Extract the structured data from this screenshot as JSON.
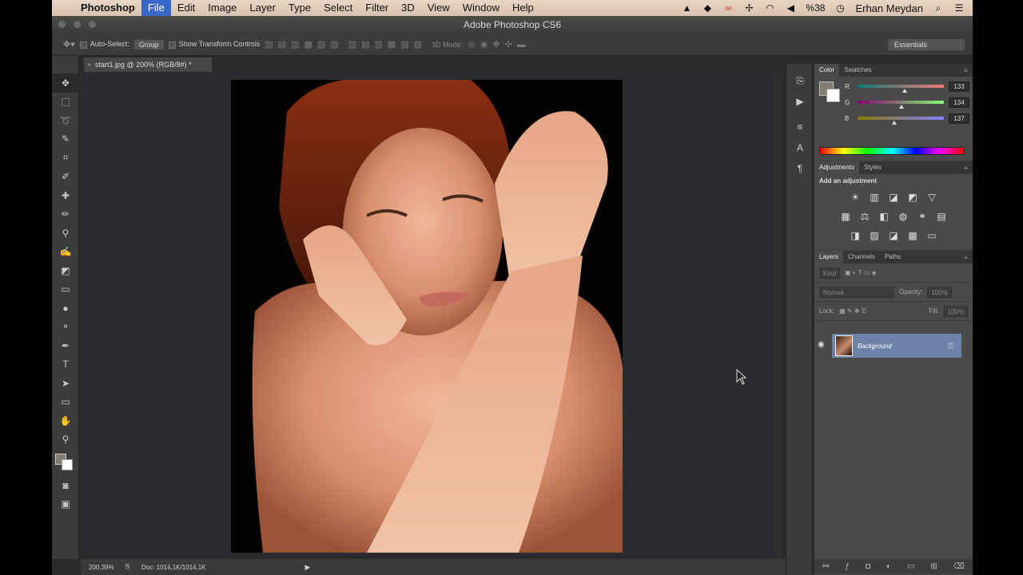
{
  "menubar": {
    "apple": "",
    "items": [
      {
        "label": "Photoshop"
      },
      {
        "label": "File"
      },
      {
        "label": "Edit"
      },
      {
        "label": "Image"
      },
      {
        "label": "Layer"
      },
      {
        "label": "Type"
      },
      {
        "label": "Select"
      },
      {
        "label": "Filter"
      },
      {
        "label": "3D"
      },
      {
        "label": "View"
      },
      {
        "label": "Window"
      },
      {
        "label": "Help"
      }
    ],
    "battery": "%38",
    "user": "Erhan Meydan",
    "search_icon": "magnifier"
  },
  "window": {
    "title": "Adobe Photoshop CS6"
  },
  "options": {
    "auto_select_label": "Auto-Select:",
    "group_value": "Group",
    "show_transform_label": "Show Transform Controls",
    "mode_3d_label": "3D Mode:",
    "workspace_value": "Essentials"
  },
  "document": {
    "tab_label": "start1.jpg @ 200% (RGB/8#) *",
    "zoom": "200,39%",
    "doc_info": "Doc: 1014,1K/1014,1K"
  },
  "tools": [
    "move-tool",
    "marquee-tool",
    "lasso-tool",
    "quick-select-tool",
    "crop-tool",
    "eyedropper-tool",
    "healing-brush-tool",
    "brush-tool",
    "clone-stamp-tool",
    "history-brush-tool",
    "eraser-tool",
    "gradient-tool",
    "blur-tool",
    "dodge-tool",
    "pen-tool",
    "type-tool",
    "path-select-tool",
    "rectangle-tool",
    "hand-tool",
    "zoom-tool"
  ],
  "color_panel": {
    "tabs": [
      {
        "label": "Color"
      },
      {
        "label": "Swatches"
      }
    ],
    "rows": [
      {
        "label": "R",
        "value": "133",
        "fraction": 0.52
      },
      {
        "label": "G",
        "value": "134",
        "fraction": 0.48
      },
      {
        "label": "B",
        "value": "137",
        "fraction": 0.4
      }
    ],
    "foreground": "#857d73",
    "background": "#ffffff"
  },
  "adjustments_panel": {
    "tabs": [
      {
        "label": "Adjustments"
      },
      {
        "label": "Styles"
      }
    ],
    "title": "Add an adjustment"
  },
  "layers_panel": {
    "tabs": [
      {
        "label": "Layers"
      },
      {
        "label": "Channels"
      },
      {
        "label": "Paths"
      }
    ],
    "kind_label": "Kind",
    "blend_mode": "Normal",
    "opacity_label": "Opacity:",
    "opacity_value": "100%",
    "lock_label": "Lock:",
    "fill_label": "Fill:",
    "fill_value": "100%",
    "layers": [
      {
        "name": "Background",
        "visible": true,
        "locked": true,
        "selected": true
      }
    ]
  },
  "colors": {
    "selection": "#6d82a8",
    "menu_active": "#3a66c8"
  }
}
